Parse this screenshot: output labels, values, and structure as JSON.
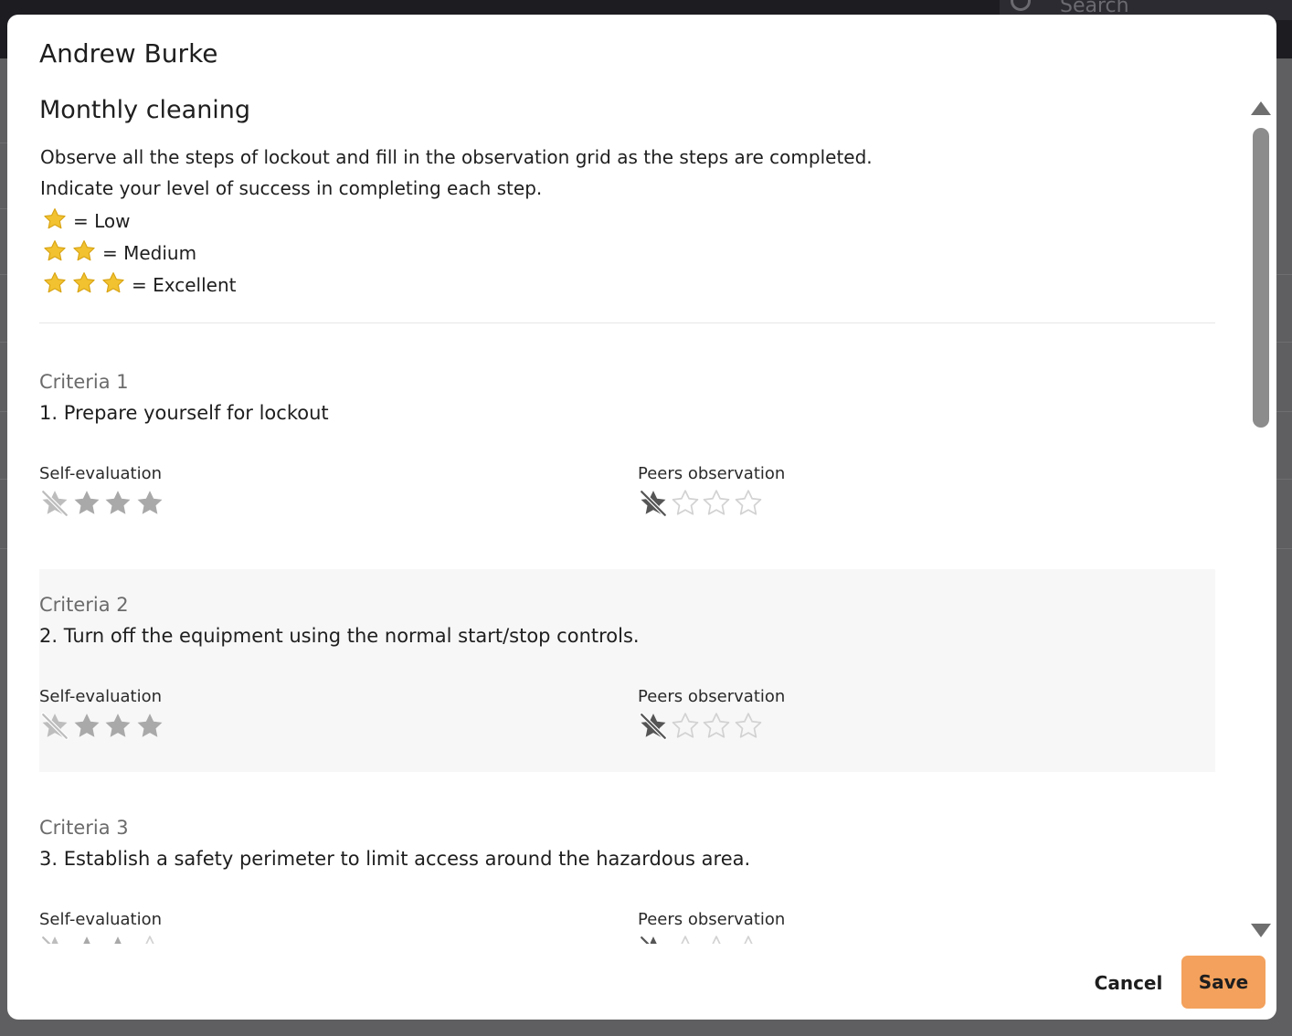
{
  "background": {
    "search_placeholder": "Search"
  },
  "modal": {
    "title": "Andrew Burke",
    "form_title": "Monthly cleaning",
    "description_lines": [
      "Observe all the steps of lockout and fill in the observation grid as the steps are completed.",
      "Indicate your level of success in completing each step."
    ],
    "legend": [
      {
        "stars": 1,
        "label": "= Low"
      },
      {
        "stars": 2,
        "label": "= Medium"
      },
      {
        "stars": 3,
        "label": "= Excellent"
      }
    ],
    "self_label": "Self-evaluation",
    "peers_label": "Peers observation",
    "criteria": [
      {
        "title": "Criteria 1",
        "text": "1. Prepare yourself for lockout",
        "self_rating": 3,
        "peers_rating": 0
      },
      {
        "title": "Criteria 2",
        "text": "2. Turn off the equipment using the normal start/stop controls.",
        "self_rating": 3,
        "peers_rating": 0
      },
      {
        "title": "Criteria 3",
        "text": "3. Establish a safety perimeter to limit access around the hazardous area.",
        "self_rating": 2,
        "peers_rating": 0
      }
    ],
    "max_stars": 3,
    "cancel_label": "Cancel",
    "save_label": "Save"
  },
  "colors": {
    "legend_star": "#f2c230",
    "star_filled": "#a9a9a9",
    "star_empty": "#d2d2d2",
    "peers_none_icon": "#555555",
    "self_none_icon": "#bdbdbd",
    "save_button": "#f3a15c"
  },
  "icons": {
    "legend_star": "star-icon",
    "rating_none": "no-rating-icon",
    "rating_star": "rating-star-icon"
  }
}
